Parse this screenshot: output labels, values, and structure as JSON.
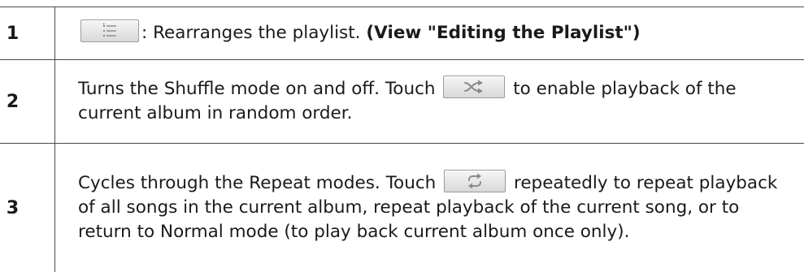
{
  "rows": [
    {
      "number": "1",
      "button_icon": "playlist-icon",
      "text_after_icon": ": Rearranges the playlist. ",
      "bold_text": "(View \"Editing the Playlist\")"
    },
    {
      "number": "2",
      "text_before_icon": "Turns the Shuffle mode on and off. Touch ",
      "button_icon": "shuffle-icon",
      "text_after_icon": " to enable playback of the current album in random order."
    },
    {
      "number": "3",
      "text_before_icon": "Cycles through the Repeat modes. Touch ",
      "button_icon": "repeat-icon",
      "text_after_icon": " repeatedly to repeat playback of all songs in the current album, repeat playback of the current song, or to return to Normal mode (to play back current album once only)."
    }
  ],
  "colors": {
    "border": "#4a4a4a",
    "text": "#1a1a1a",
    "button_border": "#9a9a9a",
    "icon": "#8a8a8a"
  }
}
